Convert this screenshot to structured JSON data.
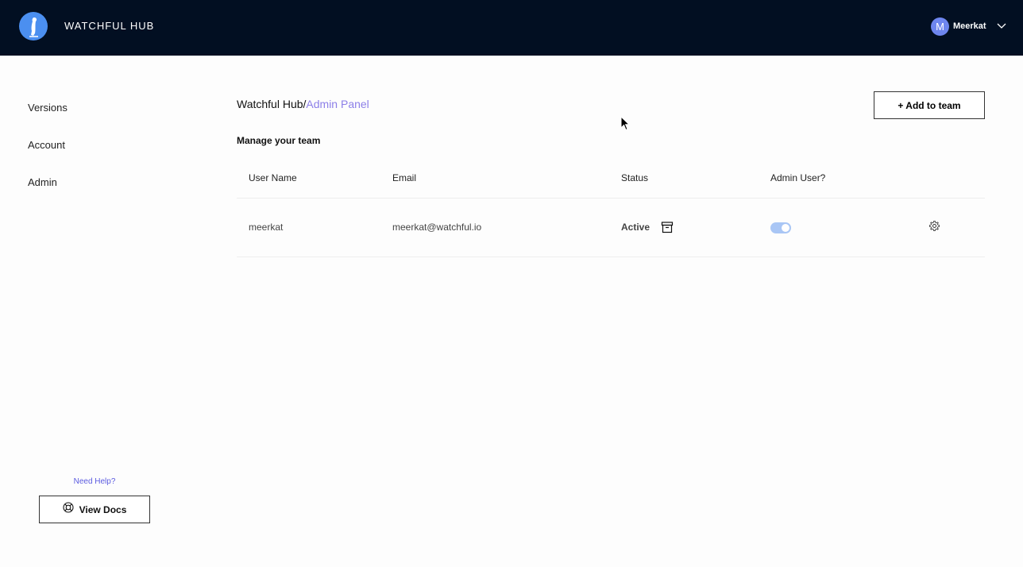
{
  "header": {
    "brand": "WATCHFUL HUB",
    "logo_icon": "meerkat-logo-icon",
    "user_initial": "M",
    "user_name": "Meerkat"
  },
  "sidebar": {
    "items": [
      {
        "label": "Versions"
      },
      {
        "label": "Account"
      },
      {
        "label": "Admin"
      }
    ],
    "help_label": "Need Help?",
    "docs_label": "View Docs"
  },
  "breadcrumb": {
    "root": "Watchful Hub/",
    "current": "Admin Panel"
  },
  "toolbar": {
    "add_label": "+ Add to team"
  },
  "section_title": "Manage your team",
  "table": {
    "columns": [
      "User Name",
      "Email",
      "Status",
      "Admin User?"
    ],
    "rows": [
      {
        "user_name": "meerkat",
        "email": "meerkat@watchful.io",
        "status": "Active",
        "admin": true
      }
    ]
  },
  "colors": {
    "topbar": "#020f22",
    "logo": "#4b8ff0",
    "avatar": "#6e86ef",
    "accent": "#8c7fe8",
    "link": "#5b5be0",
    "toggle_on": "#a9c6f5"
  }
}
